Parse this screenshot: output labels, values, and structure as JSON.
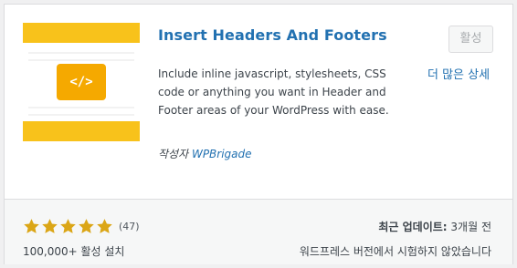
{
  "plugin": {
    "icon_name": "code-brackets-icon",
    "icon_glyph": "</>",
    "title": "Insert Headers And Footers",
    "activate_label": "활성",
    "more_details_label": "더 많은 상세",
    "description": "Include inline javascript, stylesheets, CSS code or anything you want in Header and Footer areas of your WordPress with ease.",
    "author_prefix": "작성자",
    "author_name": "WPBrigade"
  },
  "footer": {
    "rating": 5,
    "rating_max": 5,
    "rating_count": "(47)",
    "installs": "100,000+ 활성 설치",
    "last_updated_label": "최근 업데이트:",
    "last_updated_value": "3개월 전",
    "compatibility": "워드프레스 버전에서 시험하지 않았습니다"
  },
  "colors": {
    "accent_link": "#2271b1",
    "icon_yellow": "#f8c21b",
    "icon_orange": "#f5a900",
    "star": "#dba617"
  }
}
